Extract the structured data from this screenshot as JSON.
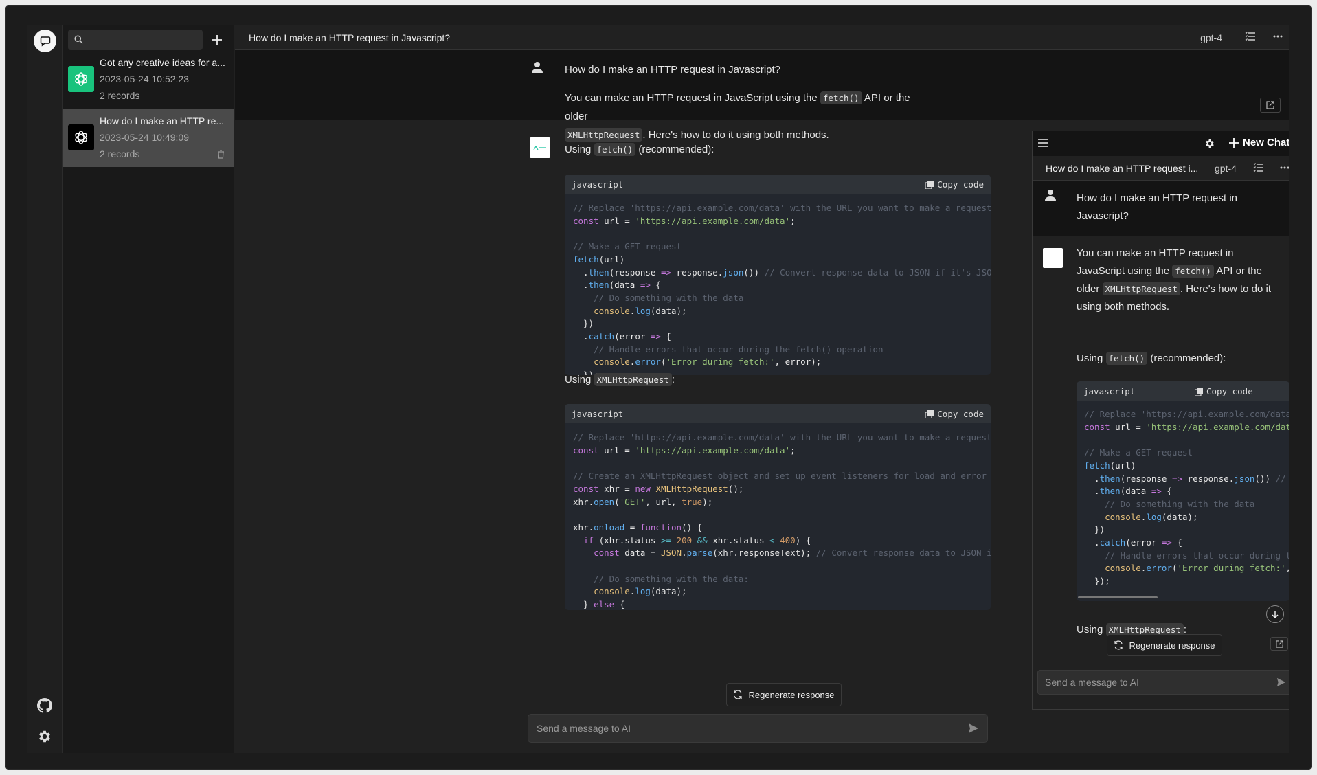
{
  "rail": {
    "logo_icon": "chat-bubble-icon",
    "github_icon": "github-icon",
    "settings_icon": "gear-icon"
  },
  "list": {
    "search_placeholder": "",
    "conversations": [
      {
        "title": "Got any creative ideas for a...",
        "date": "2023-05-24 10:52:23",
        "records": "2 records",
        "avatar_color": "#19c37d",
        "active": false
      },
      {
        "title": "How do I make an HTTP re...",
        "date": "2023-05-24 10:49:09",
        "records": "2 records",
        "avatar_color": "#000000",
        "active": true
      }
    ]
  },
  "main": {
    "title": "How do I make an HTTP request in Javascript?",
    "model": "gpt-4",
    "user_message": "How do I make an HTTP request in Javascript?",
    "assistant": {
      "p1_a": "You can make an HTTP request in JavaScript using the",
      "p1_code1": "fetch()",
      "p1_b": "API or the older",
      "p1_code2": "XMLHttpRequest",
      "p1_c": ". Here's how to do it using both methods.",
      "p2_a": "Using",
      "p2_code": "fetch()",
      "p2_b": "(recommended):",
      "p3_a": "Using",
      "p3_code": "XMLHttpRequest",
      "p3_b": ":",
      "code_lang": "javascript",
      "copy_label": "Copy code"
    },
    "regenerate_label": "Regenerate response",
    "input_placeholder": "Send a message to AI"
  },
  "panel": {
    "new_chat_label": "New Chat",
    "title": "How do I make an HTTP request i...",
    "model": "gpt-4",
    "user_message": "How do I make an HTTP request in Javascript?",
    "regenerate_label": "Regenerate response",
    "input_placeholder": "Send a message to AI"
  },
  "colors": {
    "accent_green": "#19c37d",
    "background": "#212121",
    "sidebar": "#191919"
  }
}
